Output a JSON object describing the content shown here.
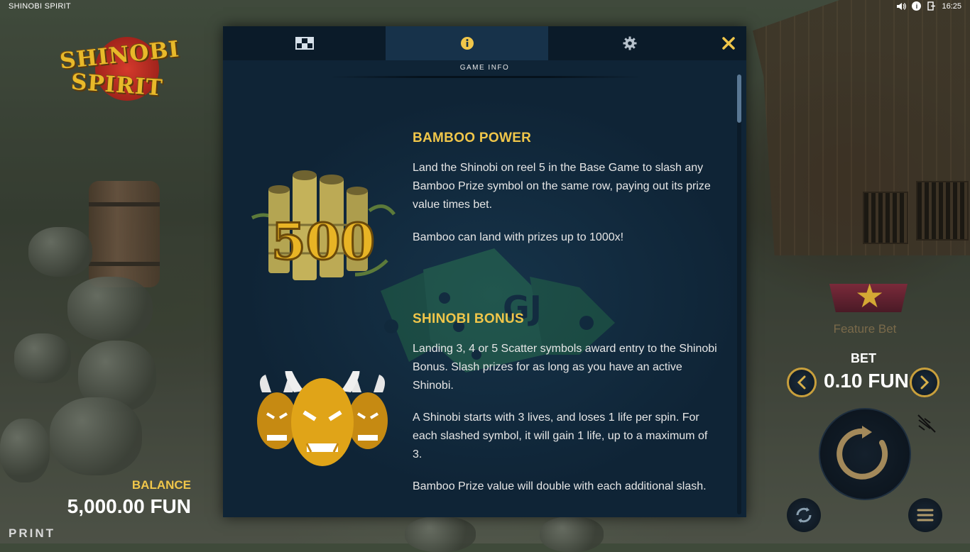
{
  "game": {
    "title": "SHINOBI SPIRIT"
  },
  "system_bar": {
    "time": "16:25",
    "icons": [
      "volume-icon",
      "info-icon",
      "exit-icon"
    ]
  },
  "logo": {
    "line1": "SHINOBI",
    "line2": "SPIRIT"
  },
  "balance": {
    "label": "BALANCE",
    "value": "5,000.00 FUN"
  },
  "print_label": "PRINT",
  "controls": {
    "feature_bet_label": "Feature Bet",
    "bet_label": "BET",
    "bet_value": "0.10 FUN",
    "icons": [
      "chevron-left-icon",
      "chevron-right-icon",
      "spin-icon",
      "autoplay-icon",
      "menu-icon",
      "turbo-off-icon"
    ]
  },
  "modal": {
    "tabs": [
      {
        "icon": "paytable-icon",
        "active": false
      },
      {
        "icon": "info-icon",
        "active": true
      },
      {
        "icon": "gear-icon",
        "active": false
      }
    ],
    "close_icon": "close-icon",
    "section_title": "GAME INFO",
    "features": [
      {
        "title": "BAMBOO POWER",
        "image": "bamboo-500-symbol",
        "image_text": "500",
        "paragraphs": [
          "Land the Shinobi on reel 5 in the Base Game to slash any Bamboo Prize symbol on the same row, paying out its prize value times bet.",
          "Bamboo can land with prizes up to 1000x!"
        ]
      },
      {
        "title": "SHINOBI BONUS",
        "image": "golden-oni-masks-symbol",
        "paragraphs": [
          "Landing 3, 4 or 5 Scatter symbols award entry to the Shinobi Bonus. Slash prizes for as long as you have an active Shinobi.",
          "A Shinobi starts with 3 lives, and loses 1 life per spin. For each slashed symbol, it will gain 1 life, up to a maximum of 3.",
          "Bamboo Prize value will double with each additional slash."
        ]
      }
    ]
  },
  "colors": {
    "accent": "#f0c64a",
    "modal_bg": "#0f2436",
    "tab_active": "#17324a"
  }
}
